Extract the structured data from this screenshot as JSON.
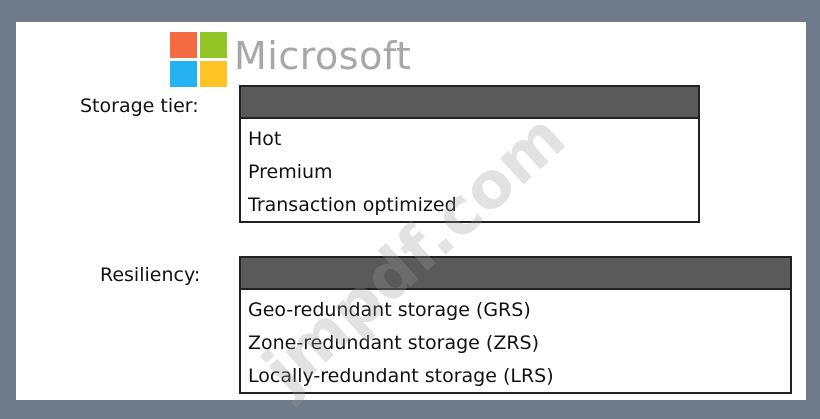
{
  "logo": {
    "text": "Microsoft",
    "colors": [
      "#f25022",
      "#7fba00",
      "#00a4ef",
      "#ffb900"
    ]
  },
  "storage_tier": {
    "label": "Storage tier:",
    "selected": "",
    "options": [
      "Hot",
      "Premium",
      "Transaction optimized"
    ]
  },
  "resiliency": {
    "label": "Resiliency:",
    "selected": "",
    "options": [
      "Geo-redundant storage (GRS)",
      "Zone-redundant storage (ZRS)",
      "Locally-redundant storage (LRS)"
    ]
  },
  "watermark": "jmpdf.com"
}
